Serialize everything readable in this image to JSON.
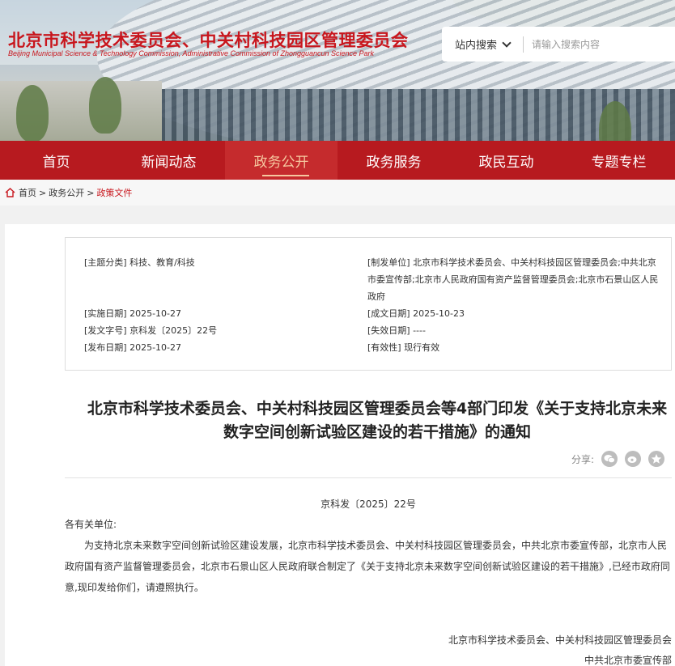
{
  "site": {
    "title": "北京市科学技术委员会、中关村科技园区管理委员会",
    "subtitle": "Beijing Municipal Science & Technology Commission, Administrative Commission of Zhongguancun Science Park"
  },
  "search": {
    "scope": "站内搜索",
    "placeholder": "请输入搜索内容"
  },
  "nav": {
    "items": [
      "首页",
      "新闻动态",
      "政务公开",
      "政务服务",
      "政民互动",
      "专题专栏"
    ],
    "active_index": 2
  },
  "breadcrumb": {
    "items": [
      "首页",
      "政务公开",
      "政策文件"
    ],
    "separator": ">"
  },
  "meta": {
    "subject_category": "[主题分类] 科技、教育/科技",
    "issuing_unit": "[制发单位] 北京市科学技术委员会、中关村科技园区管理委员会;中共北京市委宣传部;北京市人民政府国有资产监督管理委员会;北京市石景山区人民政府",
    "effective_date": "[实施日期] 2025-10-27",
    "created_date": "[成文日期] 2025-10-23",
    "doc_number": "[发文字号] 京科发〔2025〕22号",
    "expiry_date": "[失效日期] ----",
    "publish_date": "[发布日期] 2025-10-27",
    "validity": "[有效性] 现行有效"
  },
  "article": {
    "title": "北京市科学技术委员会、中关村科技园区管理委员会等4部门印发《关于支持北京未来数字空间创新试验区建设的若干措施》的通知",
    "share_label": "分享:",
    "doc_number": "京科发〔2025〕22号",
    "salutation": "各有关单位:",
    "body": "为支持北京未来数字空间创新试验区建设发展，北京市科学技术委员会、中关村科技园区管理委员会，中共北京市委宣传部，北京市人民政府国有资产监督管理委员会，北京市石景山区人民政府联合制定了《关于支持北京未来数字空间创新试验区建设的若干措施》,已经市政府同意,现印发给你们，请遵照执行。",
    "signatory_1": "北京市科学技术委员会、中关村科技园区管理委员会",
    "signatory_2": "中共北京市委宣传部"
  },
  "colors": {
    "brand_red": "#b71a1f",
    "title_red": "#c8161d",
    "active_nav_text": "#f6c8a0"
  },
  "icons": [
    "home-icon",
    "chevron-down-icon",
    "wechat-icon",
    "weibo-icon",
    "qzone-icon"
  ]
}
